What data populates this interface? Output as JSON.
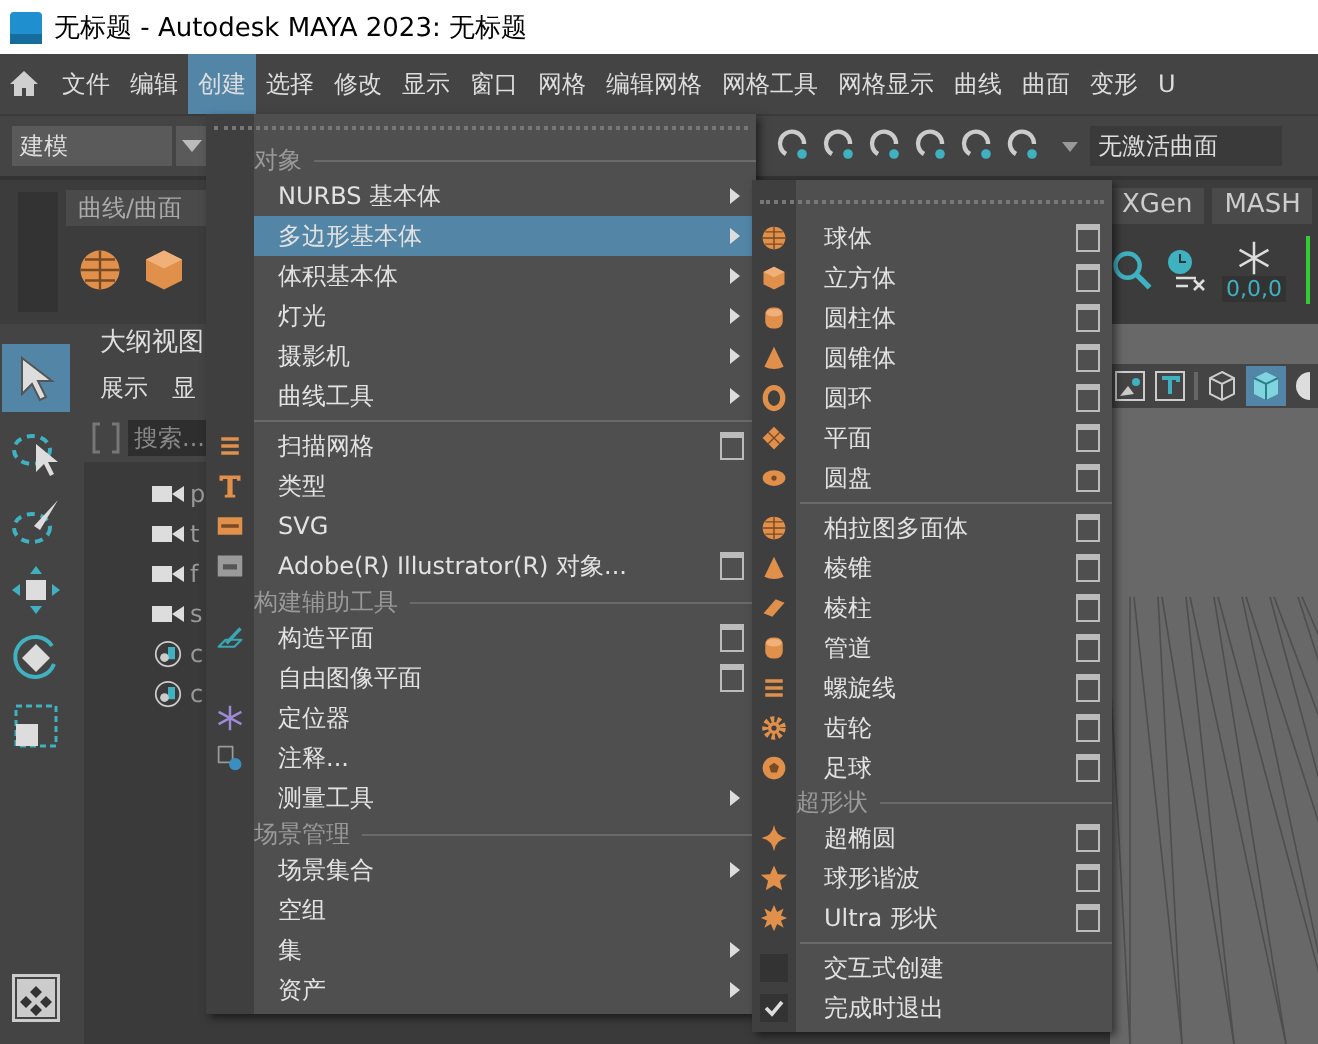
{
  "window": {
    "title": "无标题 - Autodesk MAYA 2023: 无标题"
  },
  "menubar": [
    {
      "label": "文件",
      "selected": false
    },
    {
      "label": "编辑",
      "selected": false
    },
    {
      "label": "创建",
      "selected": true
    },
    {
      "label": "选择",
      "selected": false
    },
    {
      "label": "修改",
      "selected": false
    },
    {
      "label": "显示",
      "selected": false
    },
    {
      "label": "窗口",
      "selected": false
    },
    {
      "label": "网格",
      "selected": false
    },
    {
      "label": "编辑网格",
      "selected": false
    },
    {
      "label": "网格工具",
      "selected": false
    },
    {
      "label": "网格显示",
      "selected": false
    },
    {
      "label": "曲线",
      "selected": false
    },
    {
      "label": "曲面",
      "selected": false
    },
    {
      "label": "变形",
      "selected": false
    },
    {
      "label": "U",
      "selected": false
    }
  ],
  "toolbar": {
    "mode": "建模",
    "surface_field": "无激活曲面"
  },
  "shelf": {
    "tabs": [
      {
        "label": "曲线/曲面"
      },
      {
        "label": "XGen"
      },
      {
        "label": "MASH"
      }
    ],
    "reading": "0,0,0"
  },
  "outliner": {
    "title": "大纲视图",
    "menu": [
      "展示",
      "显"
    ],
    "search": {
      "placeholder": "搜索..."
    },
    "items": [
      {
        "label": "p",
        "kind": "camera"
      },
      {
        "label": "t",
        "kind": "camera"
      },
      {
        "label": "f",
        "kind": "camera"
      },
      {
        "label": "s",
        "kind": "camera"
      },
      {
        "label": "c",
        "kind": "set"
      },
      {
        "label": "c",
        "kind": "set"
      }
    ]
  },
  "create_menu": {
    "rows": [
      {
        "kind": "header",
        "label": "对象"
      },
      {
        "kind": "item",
        "label": "NURBS 基本体",
        "submenu": true,
        "selected": false
      },
      {
        "kind": "item",
        "label": "多边形基本体",
        "submenu": true,
        "selected": true
      },
      {
        "kind": "item",
        "label": "体积基本体",
        "submenu": true,
        "selected": false
      },
      {
        "kind": "item",
        "label": "灯光",
        "submenu": true,
        "selected": false
      },
      {
        "kind": "item",
        "label": "摄影机",
        "submenu": true,
        "selected": false
      },
      {
        "kind": "item",
        "label": "曲线工具",
        "submenu": true,
        "selected": false
      },
      {
        "kind": "separator"
      },
      {
        "kind": "item",
        "label": "扫描网格",
        "options": true,
        "selected": false
      },
      {
        "kind": "item",
        "label": "类型",
        "selected": false
      },
      {
        "kind": "item",
        "label": "SVG",
        "selected": false
      },
      {
        "kind": "item",
        "label": "Adobe(R) Illustrator(R) 对象...",
        "options": true,
        "selected": false
      },
      {
        "kind": "header",
        "label": "构建辅助工具"
      },
      {
        "kind": "item",
        "label": "构造平面",
        "options": true,
        "selected": false
      },
      {
        "kind": "item",
        "label": "自由图像平面",
        "options": true,
        "selected": false
      },
      {
        "kind": "item",
        "label": "定位器",
        "selected": false
      },
      {
        "kind": "item",
        "label": "注释...",
        "selected": false
      },
      {
        "kind": "item",
        "label": "测量工具",
        "submenu": true,
        "selected": false
      },
      {
        "kind": "header",
        "label": "场景管理"
      },
      {
        "kind": "item",
        "label": "场景集合",
        "submenu": true,
        "selected": false
      },
      {
        "kind": "item",
        "label": "空组",
        "selected": false
      },
      {
        "kind": "item",
        "label": "集",
        "submenu": true,
        "selected": false
      },
      {
        "kind": "item",
        "label": "资产",
        "submenu": true,
        "selected": false
      }
    ]
  },
  "polygon_submenu": {
    "rows": [
      {
        "kind": "item",
        "label": "球体",
        "options": true,
        "selected": false
      },
      {
        "kind": "item",
        "label": "立方体",
        "options": true,
        "selected": false
      },
      {
        "kind": "item",
        "label": "圆柱体",
        "options": true,
        "selected": false
      },
      {
        "kind": "item",
        "label": "圆锥体",
        "options": true,
        "selected": false
      },
      {
        "kind": "item",
        "label": "圆环",
        "options": true,
        "selected": false
      },
      {
        "kind": "item",
        "label": "平面",
        "options": true,
        "selected": false
      },
      {
        "kind": "item",
        "label": "圆盘",
        "options": true,
        "selected": false
      },
      {
        "kind": "separator"
      },
      {
        "kind": "item",
        "label": "柏拉图多面体",
        "options": true,
        "selected": false
      },
      {
        "kind": "item",
        "label": "棱锥",
        "options": true,
        "selected": false
      },
      {
        "kind": "item",
        "label": "棱柱",
        "options": true,
        "selected": false
      },
      {
        "kind": "item",
        "label": "管道",
        "options": true,
        "selected": false
      },
      {
        "kind": "item",
        "label": "螺旋线",
        "options": true,
        "selected": false
      },
      {
        "kind": "item",
        "label": "齿轮",
        "options": true,
        "selected": false
      },
      {
        "kind": "item",
        "label": "足球",
        "options": true,
        "selected": false
      },
      {
        "kind": "header",
        "label": "超形状"
      },
      {
        "kind": "item",
        "label": "超椭圆",
        "options": true,
        "selected": false
      },
      {
        "kind": "item",
        "label": "球形谐波",
        "options": true,
        "selected": false
      },
      {
        "kind": "item",
        "label": "Ultra 形状",
        "options": true,
        "selected": false
      },
      {
        "kind": "separator"
      },
      {
        "kind": "checkbox",
        "label": "交互式创建",
        "checked": false
      },
      {
        "kind": "checkbox",
        "label": "完成时退出",
        "checked": true
      }
    ]
  }
}
